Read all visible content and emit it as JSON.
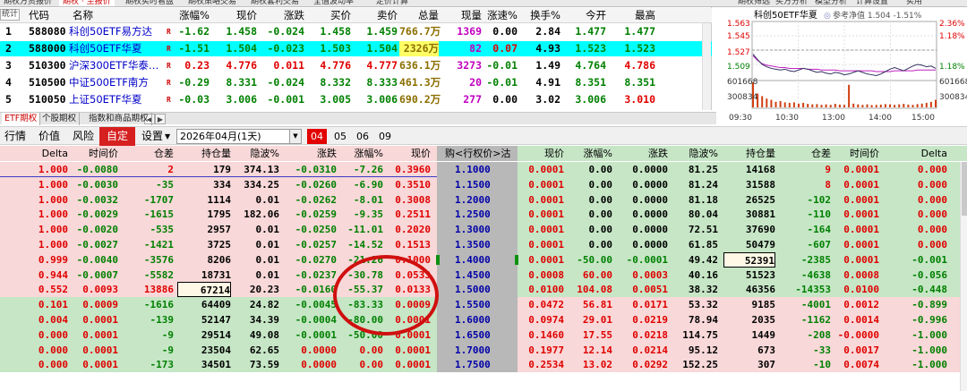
{
  "top_tabs": [
    "期权方资报价",
    "期权 · 至报价",
    "期权实时看盘",
    "期权策略交易",
    "期权套利交易",
    "全值波动率",
    "定价计算",
    "期权筛选",
    "买方分析",
    "模型分析",
    "计算设置",
    "实用"
  ],
  "quote_table": {
    "headers": [
      "代码",
      "名称",
      "涨幅%",
      "现价",
      "涨跌",
      "买价",
      "卖价",
      "总量",
      "现量",
      "涨速%",
      "换手%",
      "今开",
      "最高"
    ],
    "rows": [
      {
        "idx": "1",
        "code": "588080",
        "name": "科创50ETF易方达",
        "tag": "R",
        "chg_pct": "-1.62",
        "price": "1.458",
        "chg": "-0.024",
        "bid": "1.458",
        "ask": "1.459",
        "vol": "766.7万",
        "cur_vol": "1369",
        "speed": "0.00",
        "turnover": "2.84",
        "open": "1.477",
        "high": "1.477",
        "selected": false
      },
      {
        "idx": "2",
        "code": "588000",
        "name": "科创50ETF华夏",
        "tag": "R",
        "chg_pct": "-1.51",
        "price": "1.504",
        "chg": "-0.023",
        "bid": "1.503",
        "ask": "1.504",
        "vol": "2326万",
        "cur_vol": "82",
        "speed": "0.07",
        "turnover": "4.93",
        "open": "1.523",
        "high": "1.523",
        "selected": true
      },
      {
        "idx": "3",
        "code": "510300",
        "name": "沪深300ETF华泰…",
        "tag": "R",
        "chg_pct": "0.23",
        "price": "4.776",
        "chg": "0.011",
        "bid": "4.776",
        "ask": "4.777",
        "vol": "636.1万",
        "cur_vol": "3273",
        "speed": "-0.01",
        "turnover": "1.49",
        "open": "4.764",
        "high": "4.786",
        "selected": false
      },
      {
        "idx": "4",
        "code": "510500",
        "name": "中证500ETF南方",
        "tag": "R",
        "chg_pct": "-0.29",
        "price": "8.331",
        "chg": "-0.024",
        "bid": "8.332",
        "ask": "8.333",
        "vol": "461.3万",
        "cur_vol": "20",
        "speed": "-0.01",
        "turnover": "4.91",
        "open": "8.351",
        "high": "8.351",
        "selected": false
      },
      {
        "idx": "5",
        "code": "510050",
        "name": "上证50ETF华夏",
        "tag": "R",
        "chg_pct": "-0.03",
        "price": "3.006",
        "chg": "-0.001",
        "bid": "3.005",
        "ask": "3.006",
        "vol": "690.2万",
        "cur_vol": "277",
        "speed": "0.00",
        "turnover": "3.02",
        "open": "3.006",
        "high": "3.010",
        "selected": false
      }
    ]
  },
  "mini_chart": {
    "title": "科创50ETF华夏",
    "legend": "参考净值 1.504 -1.51%",
    "price_ticks": [
      "1.563",
      "1.545",
      "1.527",
      "1.509",
      "601668",
      "300834"
    ],
    "pct_ticks": [
      "2.36%",
      "1.18%",
      "1.18%",
      "601668",
      "300834"
    ],
    "time_ticks": [
      "09:30",
      "10:30",
      "13:00",
      "14:00",
      "15:00"
    ],
    "prev_close": 1.527,
    "price_range": [
      1.491,
      1.563
    ],
    "price_line": [
      1.522,
      1.515,
      1.509,
      1.506,
      1.504,
      1.503,
      1.502,
      1.503,
      1.501,
      1.5,
      1.502,
      1.504,
      1.503,
      1.501,
      1.499,
      1.5,
      1.498,
      1.497,
      1.499,
      1.498,
      1.496,
      1.497,
      1.499,
      1.501,
      1.499,
      1.497,
      1.496,
      1.495,
      1.497,
      1.5,
      1.503,
      1.505,
      1.503,
      1.501,
      1.504,
      1.507,
      1.509,
      1.508,
      1.506,
      1.507,
      1.504
    ],
    "avg_line": [
      1.52,
      1.514,
      1.51,
      1.508,
      1.507,
      1.506,
      1.505,
      1.505,
      1.504,
      1.504,
      1.504,
      1.504,
      1.503,
      1.503,
      1.503,
      1.502,
      1.502,
      1.502,
      1.502,
      1.501,
      1.501,
      1.501,
      1.501,
      1.501,
      1.501,
      1.501,
      1.501,
      1.5,
      1.5,
      1.5,
      1.5,
      1.501,
      1.501,
      1.501,
      1.501,
      1.501,
      1.502,
      1.502,
      1.502,
      1.502,
      1.502
    ],
    "volume": [
      1.0,
      0.55,
      0.45,
      0.35,
      0.3,
      0.22,
      0.25,
      0.2,
      0.18,
      0.2,
      0.15,
      0.18,
      0.14,
      0.12,
      0.13,
      0.1,
      0.12,
      0.1,
      0.14,
      0.11,
      0.1,
      0.9,
      0.15,
      0.12,
      0.1,
      0.12,
      0.09,
      0.1,
      0.11,
      0.13,
      0.12,
      0.1,
      0.12,
      0.14,
      0.11,
      0.1,
      0.13,
      0.15,
      0.18,
      0.22,
      0.3
    ],
    "colors": {
      "price": "#303060",
      "avg": "#c020c0",
      "up": "#e00000",
      "down": "#008000",
      "volume": "#d04010"
    }
  },
  "category_tabs": [
    "ETF期权",
    "个股期权",
    "指数和商品期权"
  ],
  "toolbar": {
    "quote": "行情",
    "value": "价值",
    "risk": "风险",
    "custom": "自定",
    "settings": "设置",
    "date": "2026年04月(1天)",
    "months": [
      "04",
      "05",
      "06",
      "09"
    ]
  },
  "board": {
    "call_headers": [
      "Delta",
      "时间价",
      "仓差",
      "持仓量",
      "隐波%",
      "涨跌",
      "涨幅%",
      "现价"
    ],
    "center_header": "购<行权价>沽",
    "put_headers": [
      "现价",
      "涨幅%",
      "涨跌",
      "隐波%",
      "持仓量",
      "仓差",
      "时间价",
      "Delta"
    ],
    "rows": [
      {
        "call": [
          "1.000",
          "-0.0080",
          "2",
          "179",
          "374.13",
          "-0.0310",
          "-7.26",
          "0.3960"
        ],
        "strike": "1.1000",
        "put": [
          "0.0001",
          "0.00",
          "0.0000",
          "81.25",
          "14168",
          "9",
          "0.0001",
          "0.000"
        ],
        "itm": true
      },
      {
        "call": [
          "1.000",
          "-0.0030",
          "-35",
          "334",
          "334.25",
          "-0.0260",
          "-6.90",
          "0.3510"
        ],
        "strike": "1.1500",
        "put": [
          "0.0001",
          "0.00",
          "0.0000",
          "81.24",
          "31588",
          "8",
          "0.0001",
          "0.000"
        ],
        "itm": true
      },
      {
        "call": [
          "1.000",
          "-0.0032",
          "-1707",
          "1114",
          "0.01",
          "-0.0262",
          "-8.01",
          "0.3008"
        ],
        "strike": "1.2000",
        "put": [
          "0.0001",
          "0.00",
          "0.0000",
          "81.18",
          "26525",
          "-102",
          "0.0001",
          "0.000"
        ],
        "itm": true
      },
      {
        "call": [
          "1.000",
          "-0.0029",
          "-1615",
          "1795",
          "182.06",
          "-0.0259",
          "-9.35",
          "0.2511"
        ],
        "strike": "1.2500",
        "put": [
          "0.0001",
          "0.00",
          "0.0000",
          "80.04",
          "30881",
          "-110",
          "0.0001",
          "0.000"
        ],
        "itm": true
      },
      {
        "call": [
          "1.000",
          "-0.0020",
          "-535",
          "2957",
          "0.01",
          "-0.0250",
          "-11.01",
          "0.2020"
        ],
        "strike": "1.3000",
        "put": [
          "0.0001",
          "0.00",
          "0.0000",
          "72.51",
          "37690",
          "-164",
          "0.0001",
          "0.000"
        ],
        "itm": true
      },
      {
        "call": [
          "1.000",
          "-0.0027",
          "-1421",
          "3725",
          "0.01",
          "-0.0257",
          "-14.52",
          "0.1513"
        ],
        "strike": "1.3500",
        "put": [
          "0.0001",
          "0.00",
          "0.0000",
          "61.85",
          "50479",
          "-607",
          "0.0001",
          "0.000"
        ],
        "itm": true
      },
      {
        "call": [
          "0.999",
          "-0.0040",
          "-3576",
          "8206",
          "0.01",
          "-0.0270",
          "-21.26",
          "0.1000"
        ],
        "strike": "1.4000",
        "put": [
          "0.0001",
          "-50.00",
          "-0.0001",
          "49.42",
          "52391",
          "-2385",
          "0.0001",
          "-0.001"
        ],
        "itm": true
      },
      {
        "call": [
          "0.944",
          "-0.0007",
          "-5582",
          "18731",
          "0.01",
          "-0.0237",
          "-30.78",
          "0.0533"
        ],
        "strike": "1.4500",
        "put": [
          "0.0008",
          "60.00",
          "0.0003",
          "40.16",
          "51523",
          "-4638",
          "0.0008",
          "-0.056"
        ],
        "itm": true
      },
      {
        "call": [
          "0.552",
          "0.0093",
          "13886",
          "67214",
          "20.23",
          "-0.0160",
          "-55.37",
          "0.0133"
        ],
        "strike": "1.5000",
        "put": [
          "0.0100",
          "104.08",
          "0.0051",
          "38.32",
          "46356",
          "-14353",
          "0.0100",
          "-0.448"
        ],
        "itm": true
      },
      {
        "call": [
          "0.101",
          "0.0009",
          "-1616",
          "64409",
          "24.82",
          "-0.0045",
          "-83.33",
          "0.0009"
        ],
        "strike": "1.5500",
        "put": [
          "0.0472",
          "56.81",
          "0.0171",
          "53.32",
          "9185",
          "-4001",
          "0.0012",
          "-0.899"
        ],
        "itm": false
      },
      {
        "call": [
          "0.004",
          "0.0001",
          "-139",
          "52147",
          "34.39",
          "-0.0004",
          "-80.00",
          "0.0001"
        ],
        "strike": "1.6000",
        "put": [
          "0.0974",
          "29.01",
          "0.0219",
          "78.94",
          "2035",
          "-1162",
          "0.0014",
          "-0.996"
        ],
        "itm": false
      },
      {
        "call": [
          "0.000",
          "0.0001",
          "-9",
          "29514",
          "49.08",
          "-0.0001",
          "-50.00",
          "0.0001"
        ],
        "strike": "1.6500",
        "put": [
          "0.1460",
          "17.55",
          "0.0218",
          "114.75",
          "1449",
          "-208",
          "-0.0000",
          "-1.000"
        ],
        "itm": false
      },
      {
        "call": [
          "0.000",
          "0.0001",
          "-9",
          "23504",
          "62.65",
          "0.0000",
          "0.00",
          "0.0001"
        ],
        "strike": "1.7000",
        "put": [
          "0.1977",
          "12.14",
          "0.0214",
          "95.12",
          "673",
          "-33",
          "0.0017",
          "-1.000"
        ],
        "itm": false
      },
      {
        "call": [
          "0.000",
          "0.0001",
          "-173",
          "34501",
          "73.59",
          "0.0000",
          "0.00",
          "0.0001"
        ],
        "strike": "1.7500",
        "put": [
          "0.2534",
          "13.02",
          "0.0292",
          "152.25",
          "307",
          "-10",
          "0.0074",
          "-1.000"
        ],
        "itm": false
      }
    ]
  },
  "colors": {
    "accent": "#e20000",
    "up": "#e00000",
    "down": "#008000",
    "selected_row": "#00ffff",
    "itm": "#f8d8d8",
    "otm": "#c6e6c6",
    "strike": "#b8b8b8"
  }
}
